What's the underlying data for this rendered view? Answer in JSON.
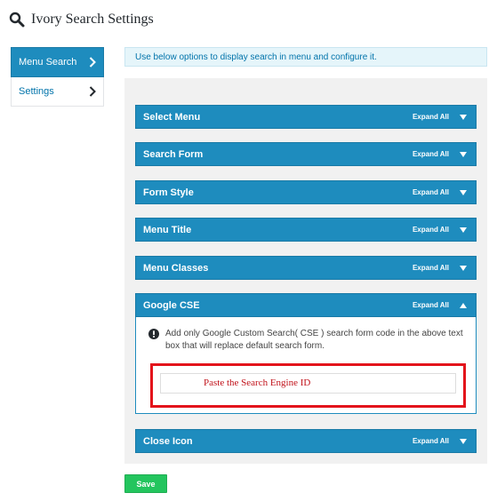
{
  "header": {
    "title": "Ivory Search Settings",
    "icon": "search-icon"
  },
  "sidebar": {
    "items": [
      {
        "label": "Menu Search",
        "active": true
      },
      {
        "label": "Settings",
        "active": false
      }
    ]
  },
  "notice": {
    "text": "Use below options to display search in menu and configure it."
  },
  "sections": [
    {
      "title": "Select Menu",
      "expand_label": "Expand All",
      "expanded": false
    },
    {
      "title": "Search Form",
      "expand_label": "Expand All",
      "expanded": false
    },
    {
      "title": "Form Style",
      "expand_label": "Expand All",
      "expanded": false
    },
    {
      "title": "Menu Title",
      "expand_label": "Expand All",
      "expanded": false
    },
    {
      "title": "Menu Classes",
      "expand_label": "Expand All",
      "expanded": false
    },
    {
      "title": "Google CSE",
      "expand_label": "Expand All",
      "expanded": true
    },
    {
      "title": "Close Icon",
      "expand_label": "Expand All",
      "expanded": false
    }
  ],
  "google_cse": {
    "info": "Add only Google Custom Search( CSE ) search form code in the above text box that will replace default search form.",
    "input_annotation": "Paste the Search Engine ID"
  },
  "save_label": "Save",
  "colors": {
    "accent": "#1e8cbe",
    "save": "#23c55e",
    "highlight": "#e3141b",
    "notice_bg": "#e5f5fa"
  }
}
